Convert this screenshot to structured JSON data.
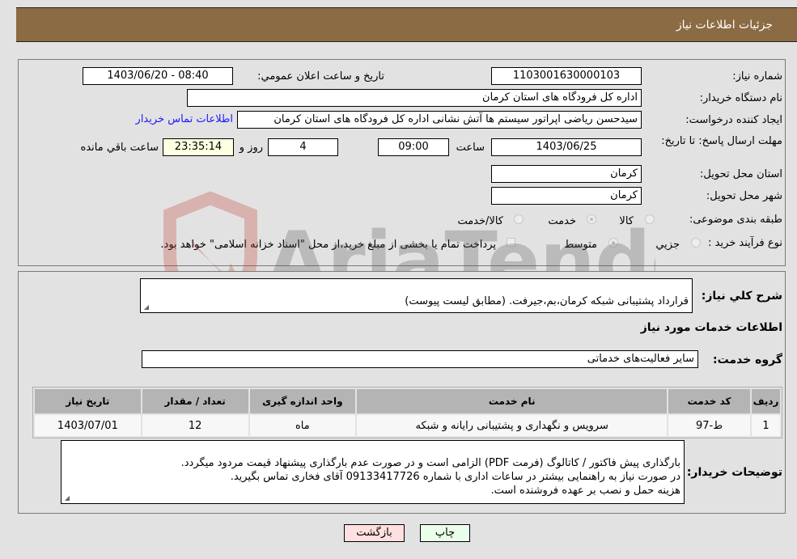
{
  "header": {
    "title": "جزئیات اطلاعات نیاز"
  },
  "form": {
    "need_number_label": "شماره نیاز:",
    "need_number": "1103001630000103",
    "announce_label": "تاریخ و ساعت اعلان عمومي:",
    "announce_value": "1403/06/20 - 08:40",
    "buyer_org_label": "نام دستگاه خریدار:",
    "buyer_org": "اداره کل فرودگاه های استان کرمان",
    "creator_label": "ایجاد کننده درخواست:",
    "creator": "سیدحسن ریاضی اپراتور سیستم ها آتش نشانی اداره کل فرودگاه های استان کرمان",
    "buyer_contact_link": "اطلاعات تماس خریدار",
    "deadline_label": "مهلت ارسال پاسخ: تا تاریخ:",
    "deadline_date": "1403/06/25",
    "time_label": "ساعت",
    "deadline_time": "09:00",
    "days_value": "4",
    "days_label": "روز و",
    "remaining_time": "23:35:14",
    "remaining_label": "ساعت باقي مانده",
    "province_label": "استان محل تحویل:",
    "province": "کرمان",
    "city_label": "شهر محل تحویل:",
    "city": "کرمان",
    "category_label": "طبقه بندی موضوعی:",
    "category_options": [
      {
        "label": "کالا",
        "selected": false
      },
      {
        "label": "خدمت",
        "selected": true
      },
      {
        "label": "کالا/خدمت",
        "selected": false
      }
    ],
    "process_label": "نوع فرآیند خرید :",
    "process_options": [
      {
        "label": "جزيي",
        "selected": false
      },
      {
        "label": "متوسط",
        "selected": true
      }
    ],
    "treasury_checkbox_label": "پرداخت تمام یا بخشی از مبلغ خرید،از محل \"اسناد خزانه اسلامی\" خواهد بود.",
    "treasury_checked": false
  },
  "details": {
    "summary_label": "شرح کلي نیاز:",
    "summary": "قرارداد پشتیبانی شبکه کرمان،بم،جیرفت. (مطابق لیست پیوست)",
    "services_heading": "اطلاعات خدمات مورد نیاز",
    "service_group_label": "گروه خدمت:",
    "service_group": "سایر فعالیت‌های خدماتی",
    "table": {
      "headers": [
        "ردیف",
        "کد خدمت",
        "نام خدمت",
        "واحد اندازه گیری",
        "تعداد / مقدار",
        "تاریخ نیاز"
      ],
      "rows": [
        [
          "1",
          "ط-97",
          "سرویس و نگهداری و پشتیبانی رایانه و شبکه",
          "ماه",
          "12",
          "1403/07/01"
        ]
      ]
    },
    "buyer_notes_label": "توضیحات خریدار:",
    "buyer_notes": "بارگذاری پیش فاکتور / کاتالوگ  (فرمت PDF) الزامی است و در صورت عدم بارگذاری پیشنهاد قیمت مردود میگردد.\nدر صورت نیاز به راهنمایی بیشتر در ساعات اداری با شماره 09133417726 آقای فخاری  تماس بگیرید.\nهزینه حمل و نصب بر عهده فروشنده است."
  },
  "buttons": {
    "print": "چاپ",
    "back": "بازگشت"
  },
  "watermark": {
    "text": "AriaTender.neT"
  },
  "colors": {
    "header_bg": "#8b6b43",
    "link": "#1a1aff",
    "print_bg": "#eaffea",
    "back_bg": "#ffe0e0",
    "remaining_bg": "#ffffe1"
  }
}
